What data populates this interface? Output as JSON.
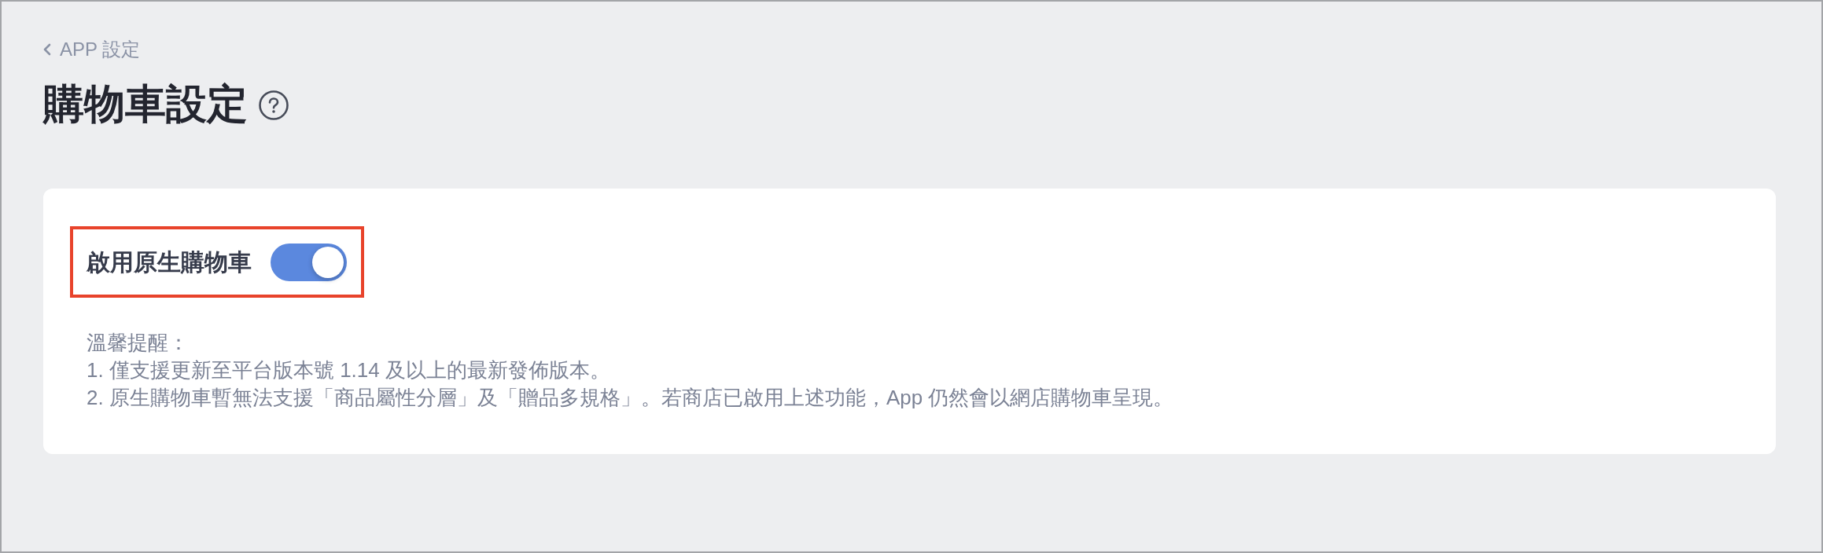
{
  "back_link": {
    "label": "APP 設定"
  },
  "page": {
    "title": "購物車設定"
  },
  "setting": {
    "label": "啟用原生購物車",
    "on": true,
    "highlighted": true
  },
  "notes": {
    "heading": "溫馨提醒：",
    "items": [
      "1. 僅支援更新至平台版本號 1.14 及以上的最新發佈版本。",
      "2. 原生購物車暫無法支援「商品屬性分層」及「贈品多規格」。若商店已啟用上述功能，App 仍然會以網店購物車呈現。"
    ]
  }
}
